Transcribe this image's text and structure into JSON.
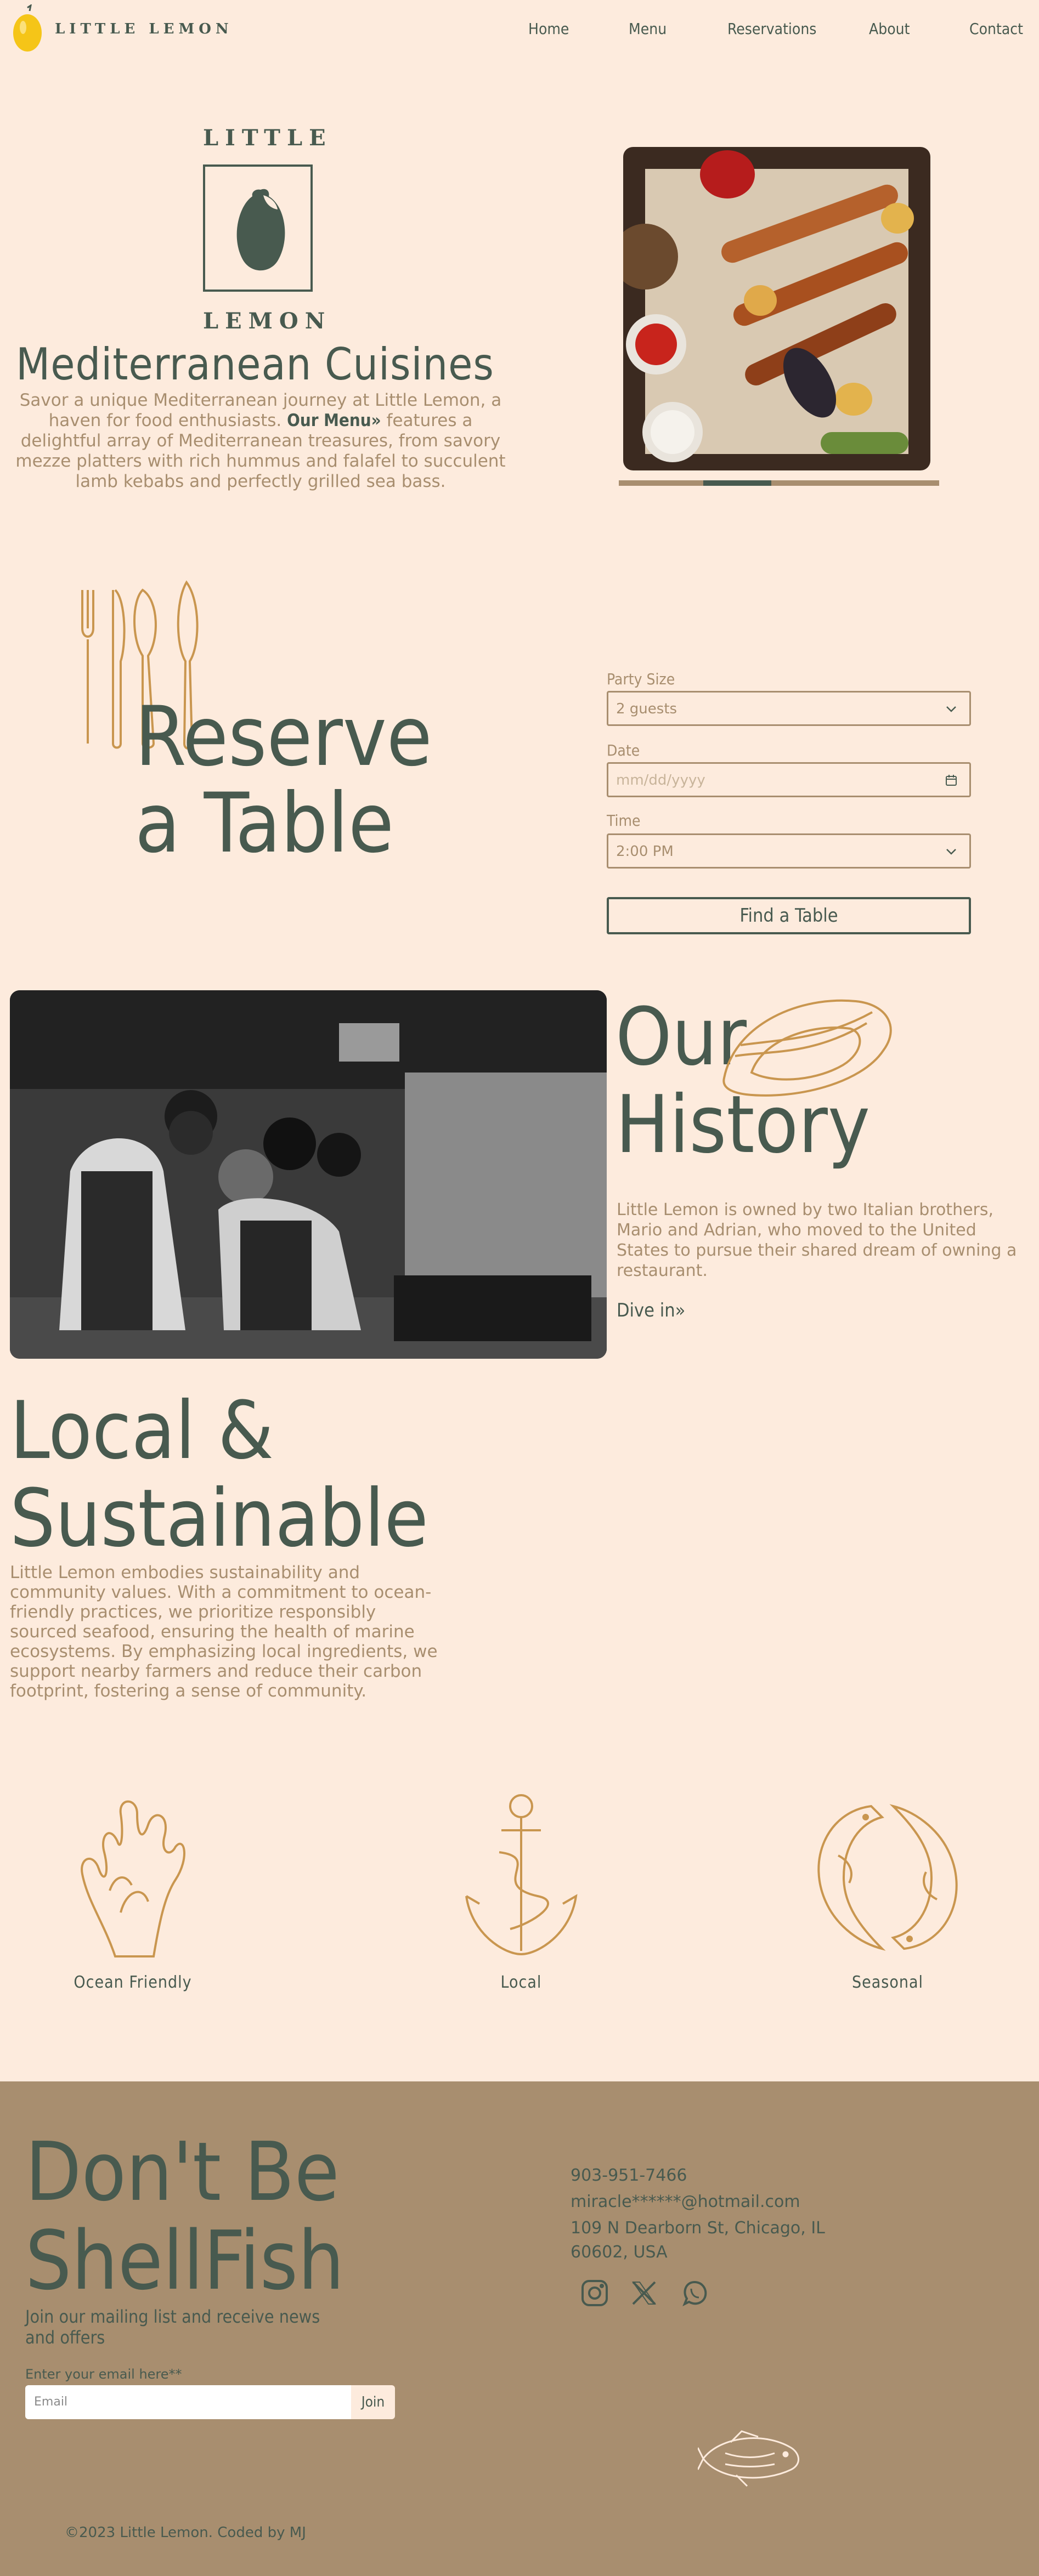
{
  "nav": {
    "brand": "LITTLE LEMON",
    "links": [
      "Home",
      "Menu",
      "Reservations",
      "About",
      "Contact"
    ]
  },
  "hero": {
    "logo_top": "LITTLE",
    "logo_bottom": "LEMON",
    "title": "Mediterranean Cuisines",
    "desc_before": "Savor a unique Mediterranean journey at Little Lemon, a haven for food enthusiasts.",
    "menu_link": "Our Menu",
    "desc_after": "features a delightful array of Mediterranean treasures, from savory mezze platters with rich hummus and falafel to succulent lamb kebabs and perfectly grilled sea bass."
  },
  "reserve": {
    "title_line1": "Reserve",
    "title_line2": "a Table",
    "party_label": "Party Size",
    "party_value": "2 guests",
    "date_label": "Date",
    "date_placeholder": "mm/dd/yyyy",
    "time_label": "Time",
    "time_value": "2:00 PM",
    "button": "Find a Table"
  },
  "history": {
    "title_line1": "Our",
    "title_line2": "History",
    "desc": "Little Lemon is owned by two Italian brothers, Mario and Adrian, who moved to the United States to pursue their shared dream of owning a restaurant.",
    "link": "Dive in"
  },
  "local": {
    "title_line1": "Local &",
    "title_line2": "Sustainable",
    "desc": "Little Lemon embodies sustainability and community values. With a commitment to ocean-friendly practices, we prioritize responsibly sourced seafood, ensuring the health of marine ecosystems. By emphasizing local ingredients, we support nearby farmers and reduce their carbon footprint, fostering a sense of community.",
    "features": [
      "Ocean Friendly",
      "Local",
      "Seasonal"
    ]
  },
  "footer": {
    "title_line1": "Don't Be",
    "title_line2": "ShellFish",
    "subtitle": "Join our mailing list and receive news and offers",
    "email_label": "Enter your email here**",
    "email_placeholder": "Email",
    "join": "Join",
    "phone": "903-951-7466",
    "email": "miracle******@hotmail.com",
    "address_line1": "109 N Dearborn St, Chicago, IL",
    "address_line2": "60602, USA",
    "copyright": "©2023 Little Lemon. Coded by MJ"
  },
  "colors": {
    "background": "#fdebdd",
    "green": "#485a4f",
    "tan": "#a88e6f"
  },
  "icons": [
    "lemon-icon",
    "chevron-down-icon",
    "calendar-icon",
    "instagram-icon",
    "x-icon",
    "whatsapp-icon",
    "fish-icon",
    "coral-icon",
    "anchor-icon",
    "koi-icon",
    "oyster-icon",
    "utensils-icon"
  ]
}
